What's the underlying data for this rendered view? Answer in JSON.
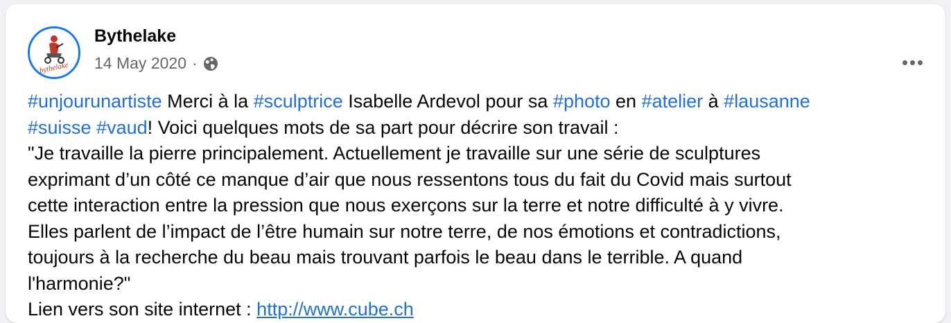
{
  "post": {
    "page_name": "Bythelake",
    "date": "14 May 2020",
    "separator": "·",
    "privacy_icon": "globe-icon",
    "more_icon": "more-horizontal-icon",
    "avatar_alt": "bythelake"
  },
  "text": {
    "line1": {
      "tag_unjour": "#unjourunartiste",
      "t1": " Merci à la ",
      "tag_sculptrice": "#sculptrice",
      "t2": " Isabelle Ardevol pour sa ",
      "tag_photo": "#photo",
      "t3": " en ",
      "tag_atelier": "#atelier",
      "t4": " à ",
      "tag_lausanne": "#lausanne"
    },
    "line2": {
      "tag_suisse": "#suisse",
      "t1": " ",
      "tag_vaud": "#vaud",
      "t2": "! Voici quelques mots de sa part pour décrire son travail :"
    },
    "line3": "\"Je travaille la pierre principalement.  Actuellement je travaille sur une série de sculptures",
    "line4": "exprimant d’un côté ce manque d’air que nous ressentons tous du fait du Covid mais surtout",
    "line5": "cette interaction entre la pression que nous exerçons sur la terre et notre difficulté à y vivre.",
    "line6": "Elles parlent de l’impact de l’être humain sur notre terre, de nos émotions et contradictions,",
    "line7": "toujours à la recherche du beau mais trouvant parfois le beau dans le terrible. A quand",
    "line8": "l'harmonie?\"",
    "line9": {
      "t1": "Lien vers son site internet : ",
      "link": "http://www.cube.ch"
    }
  },
  "colors": {
    "hashtag": "#216fdb",
    "avatar_border": "#1877f2",
    "text": "#050505",
    "meta": "#65676b"
  }
}
